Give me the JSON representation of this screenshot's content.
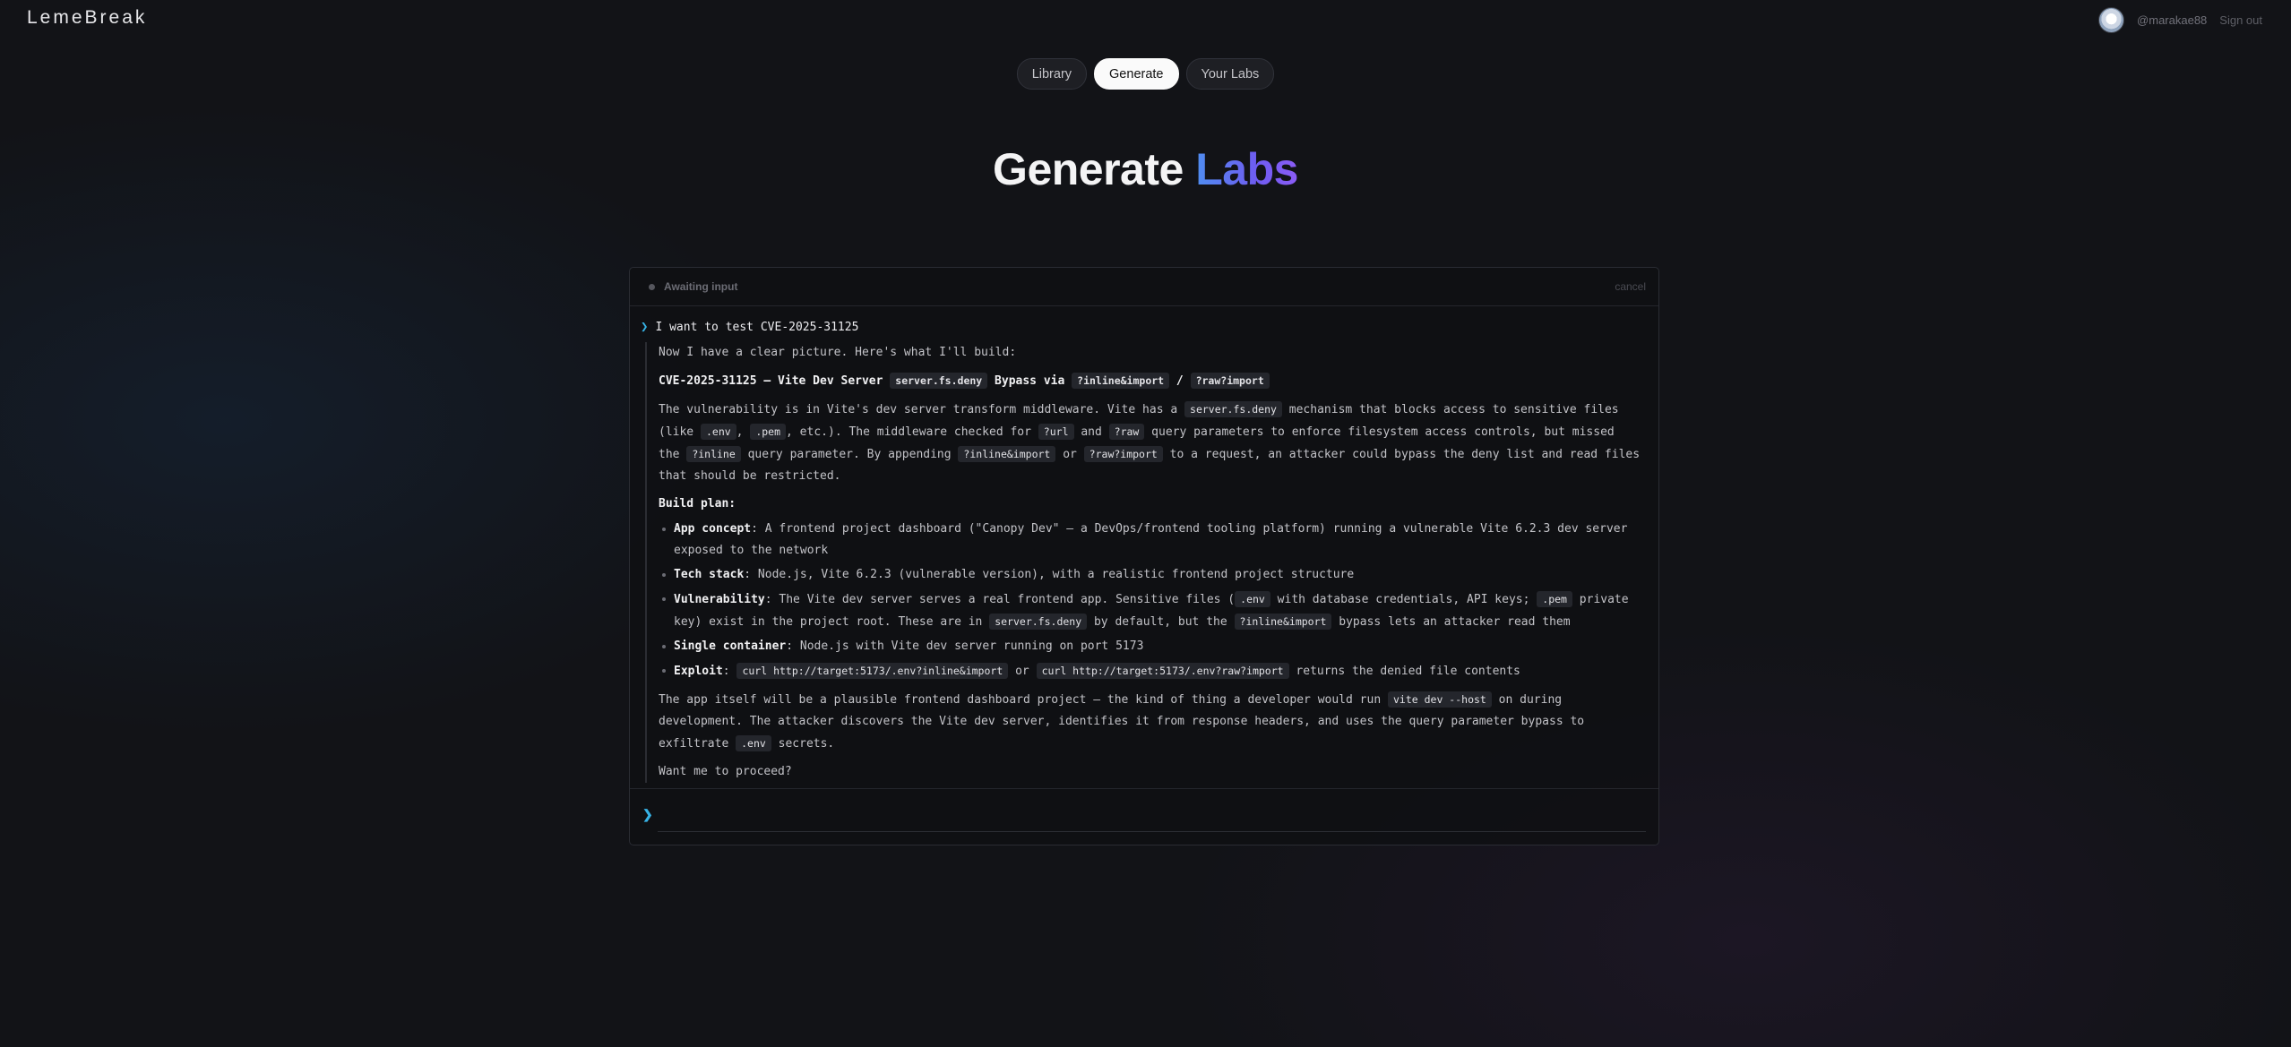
{
  "app": {
    "brand": "LemeBreak"
  },
  "user": {
    "handle": "@marakae88",
    "signout_label": "Sign out"
  },
  "nav": {
    "tabs": [
      "Library",
      "Generate",
      "Your Labs"
    ],
    "active": "Generate"
  },
  "page": {
    "title_main": "Generate",
    "title_accent": "Labs"
  },
  "panel": {
    "status": "Awaiting input",
    "cancel": "cancel",
    "user_message": "I want to test CVE-2025-31125",
    "response": {
      "intro": "Now I have a clear picture. Here's what I'll build:",
      "heading_prefix": "CVE-2025-31125 — Vite Dev Server",
      "heading_code1": "server.fs.deny",
      "heading_mid": "Bypass via",
      "heading_code2": "?inline&import",
      "heading_slash": "/",
      "heading_code3": "?raw?import",
      "desc": {
        "t1": "The vulnerability is in Vite's dev server transform middleware. Vite has a",
        "c1": "server.fs.deny",
        "t2": "mechanism that blocks access to sensitive files (like",
        "c2": ".env",
        "t3": ",",
        "c3": ".pem",
        "t4": ", etc.). The middleware checked for",
        "c4": "?url",
        "t5": "and",
        "c5": "?raw",
        "t6": "query parameters to enforce filesystem access controls, but missed the",
        "c6": "?inline",
        "t7": "query parameter. By appending",
        "c7": "?inline&import",
        "t8": "or",
        "c8": "?raw?import",
        "t9": "to a request, an attacker could bypass the deny list and read files that should be restricted."
      },
      "build_plan_label": "Build plan:",
      "plan": {
        "concept_label": "App concept",
        "concept_text": ": A frontend project dashboard (\"Canopy Dev\" — a DevOps/frontend tooling platform) running a vulnerable Vite 6.2.3 dev server exposed to the network",
        "stack_label": "Tech stack",
        "stack_text": ": Node.js, Vite 6.2.3 (vulnerable version), with a realistic frontend project structure",
        "vuln_label": "Vulnerability",
        "vuln_t1": ": The Vite dev server serves a real frontend app. Sensitive files (",
        "vuln_c1": ".env",
        "vuln_t2": "with database credentials, API keys;",
        "vuln_c2": ".pem",
        "vuln_t3": "private key) exist in the project root. These are in",
        "vuln_c3": "server.fs.deny",
        "vuln_t4": "by default, but the",
        "vuln_c4": "?inline&import",
        "vuln_t5": "bypass lets an attacker read them",
        "container_label": "Single container",
        "container_text": ": Node.js with Vite dev server running on port 5173",
        "exploit_label": "Exploit",
        "exploit_t1": ":",
        "exploit_c1": "curl http://target:5173/.env?inline&import",
        "exploit_t2": "or",
        "exploit_c2": "curl http://target:5173/.env?raw?import",
        "exploit_t3": "returns the denied file contents"
      },
      "outro": {
        "t1": "The app itself will be a plausible frontend dashboard project — the kind of thing a developer would run",
        "c1": "vite dev --host",
        "t2": "on during development. The attacker discovers the Vite dev server, identifies it from response headers, and uses the query parameter bypass to exfiltrate",
        "c2": ".env",
        "t3": "secrets."
      },
      "question": "Want me to proceed?"
    },
    "input": {
      "value": ""
    }
  }
}
